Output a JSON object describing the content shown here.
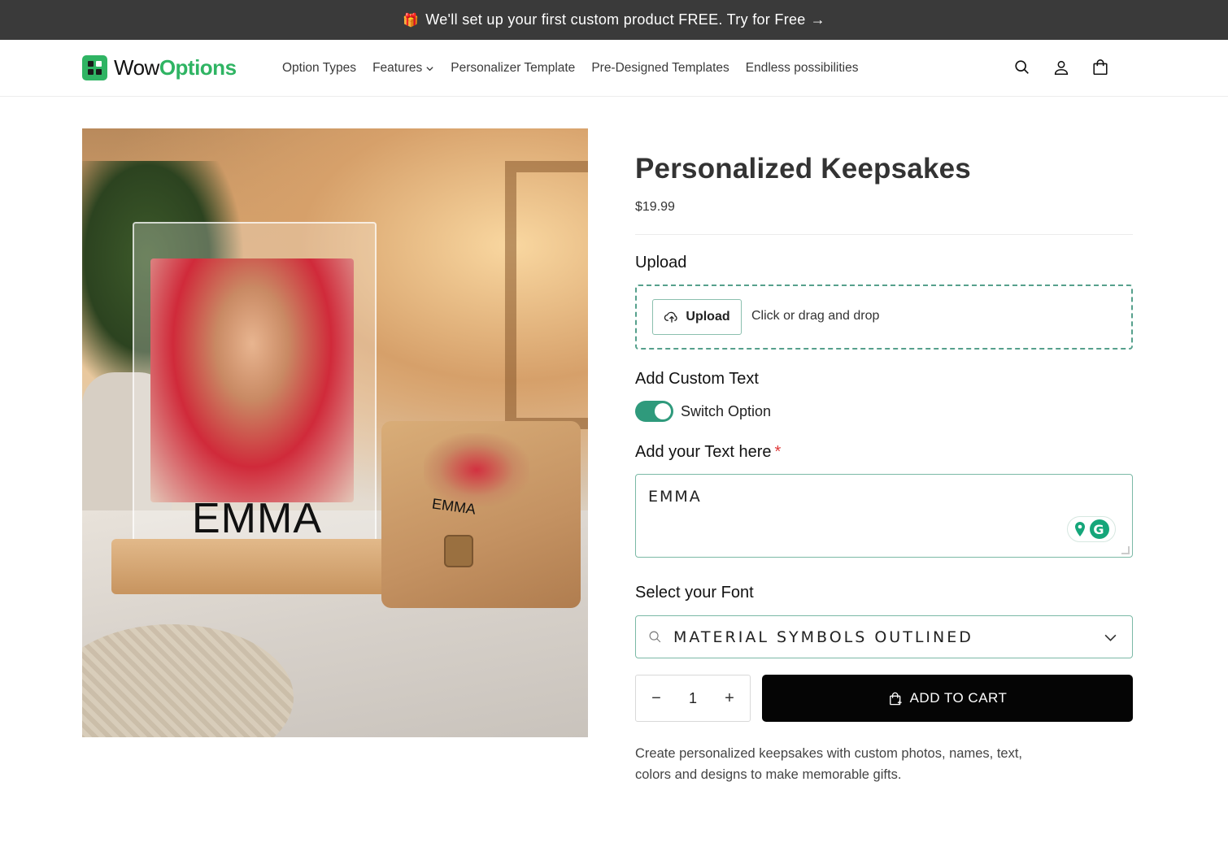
{
  "announcement": {
    "text": "We'll set up your first custom product FREE. Try for Free",
    "icon": "gift-icon",
    "arrow_icon": "arrow-right-icon"
  },
  "header": {
    "logo": {
      "word1": "Wow",
      "word2": "Options"
    },
    "nav": [
      {
        "label": "Option Types"
      },
      {
        "label": "Features",
        "has_dropdown": true
      },
      {
        "label": "Personalizer Template"
      },
      {
        "label": "Pre-Designed Templates"
      },
      {
        "label": "Endless possibilities"
      }
    ],
    "icons": [
      "search-icon",
      "account-icon",
      "cart-icon"
    ]
  },
  "product": {
    "image_text": {
      "block_name": "EMMA",
      "box_name": "EMMA"
    },
    "title": "Personalized Keepsakes",
    "price": "$19.99",
    "upload": {
      "label": "Upload",
      "button_label": "Upload",
      "hint": "Click or drag and drop"
    },
    "custom_text": {
      "label": "Add Custom Text",
      "switch_label": "Switch Option",
      "switch_on": true
    },
    "text_field": {
      "label": "Add your Text here",
      "required_mark": "*",
      "value": "EMMA"
    },
    "font": {
      "label": "Select your Font",
      "selected": "MATERIAL SYMBOLS OUTLINED"
    },
    "quantity": {
      "minus": "−",
      "value": "1",
      "plus": "+"
    },
    "add_to_cart": "ADD TO CART",
    "description": "Create personalized keepsakes with custom photos, names, text, colors and designs to make memorable gifts."
  },
  "colors": {
    "announcement_bg": "#3a3a3a",
    "brand_green": "#2fb463",
    "accent_teal": "#2f9a7c",
    "cart_button_bg": "#050505"
  }
}
